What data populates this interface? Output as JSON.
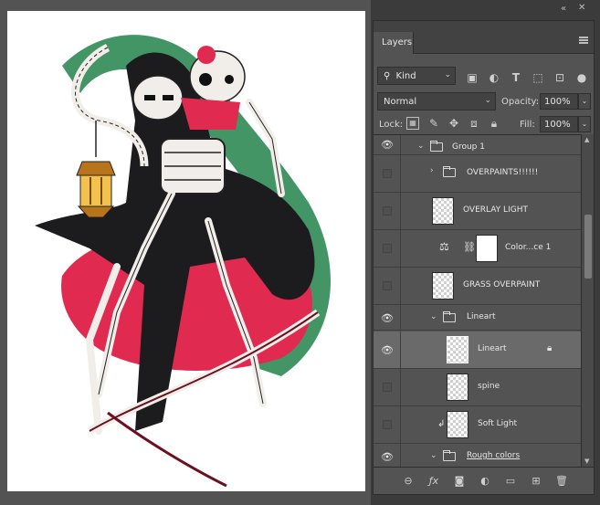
{
  "panel": {
    "tab_label": "Layers",
    "filter": {
      "kind_label": "Kind"
    },
    "blend": {
      "mode": "Normal",
      "opacity_label": "Opacity:",
      "opacity_value": "100%"
    },
    "lock": {
      "label": "Lock:",
      "fill_label": "Fill:",
      "fill_value": "100%"
    }
  },
  "layers": [
    {
      "name": "Group 1",
      "kind": "group",
      "visible": true,
      "indent": 1,
      "expanded": true
    },
    {
      "name": "OVERPAINTS!!!!!!",
      "kind": "group",
      "visible": false,
      "indent": 2,
      "expanded": false
    },
    {
      "name": "OVERLAY LIGHT",
      "kind": "pixel",
      "visible": false,
      "indent": 2
    },
    {
      "name": "Color...ce 1",
      "kind": "adjustment",
      "visible": false,
      "indent": 2
    },
    {
      "name": "GRASS OVERPAINT",
      "kind": "pixel",
      "visible": false,
      "indent": 2
    },
    {
      "name": "Lineart",
      "kind": "group",
      "visible": true,
      "indent": 2,
      "expanded": true
    },
    {
      "name": "Lineart",
      "kind": "pixel",
      "visible": true,
      "indent": 3,
      "selected": true,
      "locked": true
    },
    {
      "name": "spine",
      "kind": "pixel",
      "visible": false,
      "indent": 3
    },
    {
      "name": "Soft Light",
      "kind": "pixel",
      "visible": false,
      "indent": 3,
      "clipped": true
    },
    {
      "name": "Rough colors",
      "kind": "group",
      "visible": true,
      "indent": 2,
      "expanded": true
    }
  ],
  "icons": {
    "panel_collapse": "double-chevron-icon",
    "panel_close": "close-icon",
    "panel_menu": "hamburger-menu-icon",
    "search": "search-icon",
    "eye": "eye-icon",
    "lock": "lock-icon"
  },
  "colors": {
    "panel_bg": "#535353",
    "selected_row": "#6a6a6a",
    "canvas_bg": "#ffffff",
    "art_red": "#e02a4f",
    "art_green": "#2f8a55"
  }
}
